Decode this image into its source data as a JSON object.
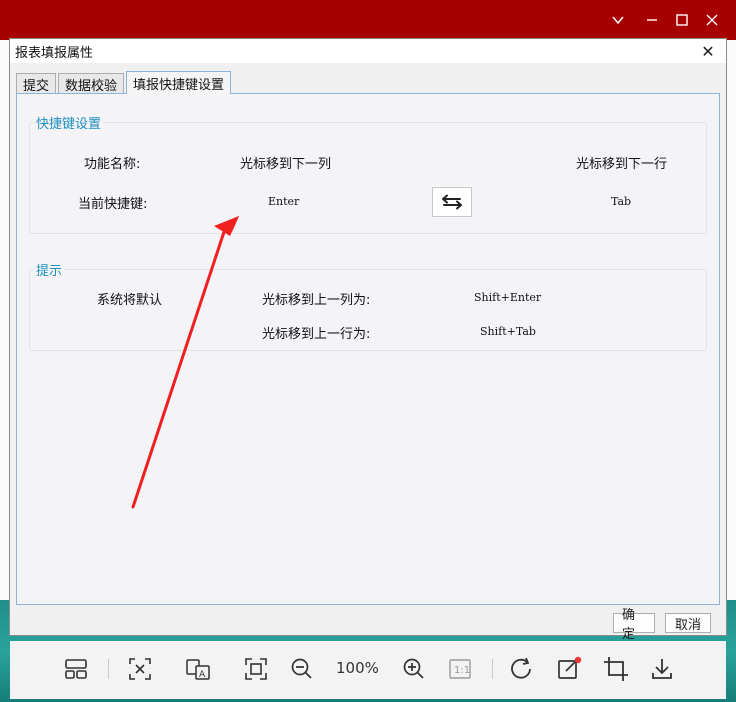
{
  "viewer": {
    "zoom_label": "100%",
    "toolbar_icons": [
      "layout-icon",
      "fit-icon",
      "translate-icon",
      "fullscreen-icon",
      "zoom-out-icon",
      "zoom-in-icon",
      "actual-size-icon",
      "rotate-icon",
      "edit-icon",
      "crop-icon",
      "download-icon"
    ],
    "accent": "#a70000"
  },
  "dialog": {
    "title": "报表填报属性",
    "close_glyph": "✕",
    "tabs": [
      {
        "label": "提交"
      },
      {
        "label": "数据校验"
      },
      {
        "label": "填报快捷键设置"
      }
    ],
    "shortcut_group": {
      "title": "快捷键设置",
      "function_label": "功能名称:",
      "current_label": "当前快捷键:",
      "col1_name": "光标移到下一列",
      "col2_name": "光标移到下一行",
      "col1_key": "Enter",
      "col2_key": "Tab"
    },
    "hint_group": {
      "title": "提示",
      "system_default": "系统将默认",
      "row1_label": "光标移到上一列为:",
      "row1_key": "Shift+Enter",
      "row2_label": "光标移到上一行为:",
      "row2_key": "Shift+Tab"
    },
    "ok_label": "确定",
    "cancel_label": "取消"
  }
}
